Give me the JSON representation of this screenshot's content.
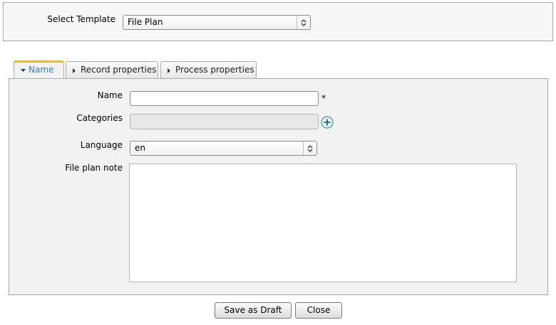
{
  "template": {
    "label": "Select Template",
    "selected": "File Plan"
  },
  "tabs": [
    {
      "label": "Name",
      "active": true
    },
    {
      "label": "Record properties",
      "active": false
    },
    {
      "label": "Process properties",
      "active": false
    }
  ],
  "form": {
    "name_label": "Name",
    "name_value": "",
    "required_marker": "*",
    "categories_label": "Categories",
    "categories_value": "",
    "language_label": "Language",
    "language_selected": "en",
    "note_label": "File plan note",
    "note_value": ""
  },
  "buttons": {
    "save_draft": "Save as Draft",
    "close": "Close"
  },
  "colors": {
    "active_tab_accent": "#f0c000",
    "active_tab_text": "#3a78c0",
    "add_icon": "#3a8fa8"
  }
}
